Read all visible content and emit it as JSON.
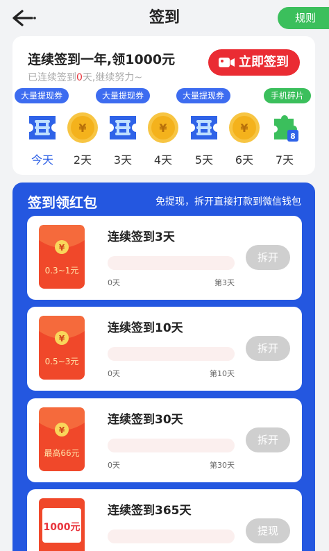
{
  "header": {
    "title": "签到",
    "rules_label": "规则"
  },
  "signin": {
    "title": "连续签到一年,领1000元",
    "subtitle_prefix": "已连续签到",
    "days_signed": "0",
    "subtitle_suffix": "天,继续努力~",
    "button_label": "立即签到",
    "days": [
      {
        "label": "今天",
        "tag": "大量提现券",
        "reward": "ticket"
      },
      {
        "label": "2天",
        "tag": "",
        "reward": "coin"
      },
      {
        "label": "3天",
        "tag": "大量提现券",
        "reward": "ticket"
      },
      {
        "label": "4天",
        "tag": "",
        "reward": "coin"
      },
      {
        "label": "5天",
        "tag": "大量提现券",
        "reward": "ticket"
      },
      {
        "label": "6天",
        "tag": "",
        "reward": "coin"
      },
      {
        "label": "7天",
        "tag": "手机碎片",
        "reward": "puzzle"
      }
    ]
  },
  "red_packets": {
    "title": "签到领红包",
    "subtitle": "免提现，拆开直接打款到微信钱包",
    "items": [
      {
        "title": "连续签到3天",
        "amount": "0.3~1元",
        "start": "0天",
        "end": "第3天",
        "progress": 0,
        "button": "拆开"
      },
      {
        "title": "连续签到10天",
        "amount": "0.5~3元",
        "start": "0天",
        "end": "第10天",
        "progress": 0,
        "button": "拆开"
      },
      {
        "title": "连续签到30天",
        "amount": "最高66元",
        "start": "0天",
        "end": "第30天",
        "progress": 0,
        "button": "拆开"
      },
      {
        "title": "连续签到365天",
        "amount": "1000元",
        "start": "",
        "end": "",
        "progress": 0,
        "button": "提现"
      }
    ]
  },
  "colors": {
    "accent_blue": "#2457e0",
    "accent_green": "#3bbf5c",
    "accent_red": "#ea2c33",
    "coin_gold": "#f4b21c"
  }
}
